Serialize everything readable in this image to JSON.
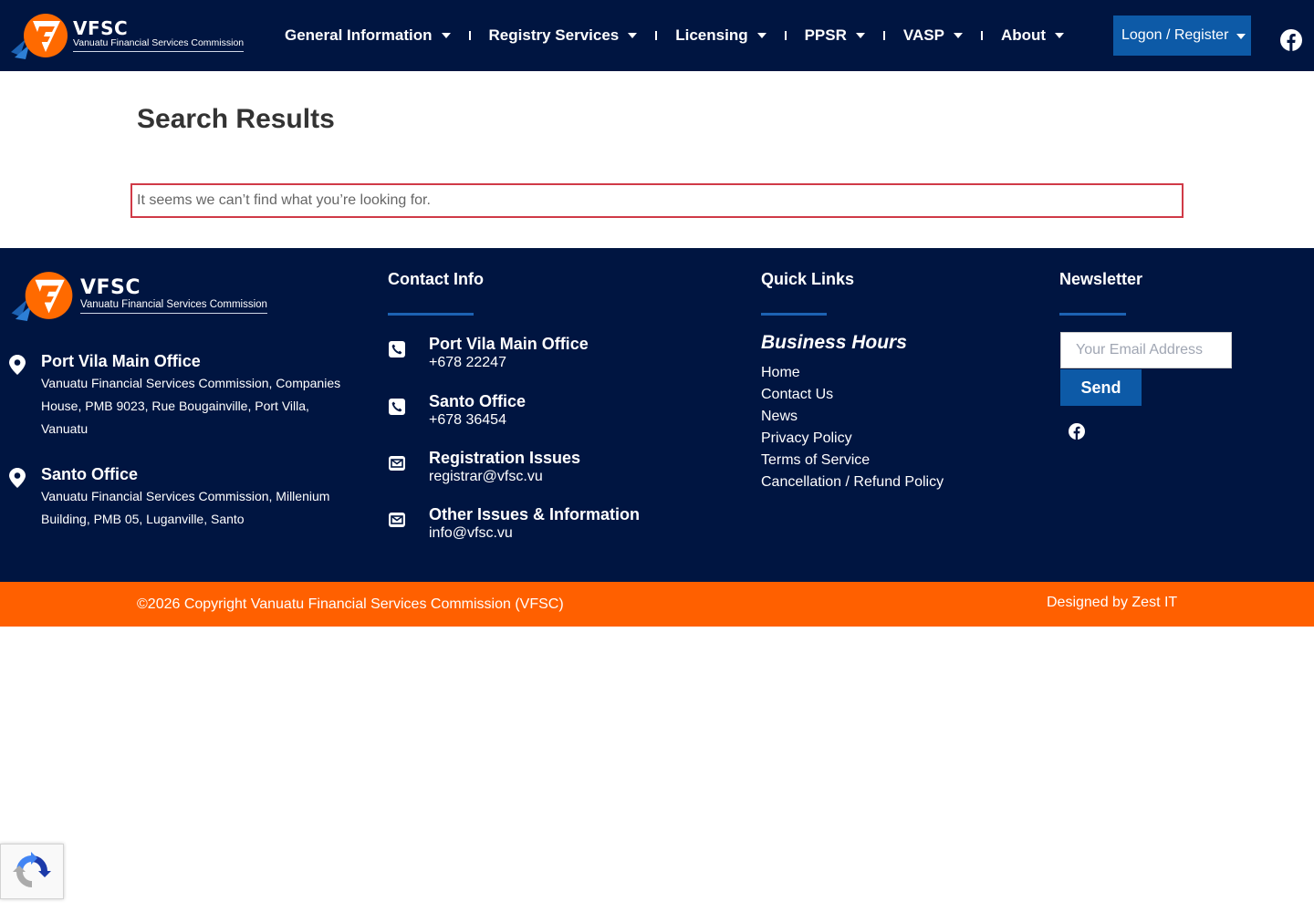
{
  "header": {
    "logo": {
      "brand": "VFSC",
      "subtitle": "Vanuatu Financial Services Commission"
    },
    "nav": [
      {
        "label": "General Information"
      },
      {
        "label": "Registry Services"
      },
      {
        "label": "Licensing"
      },
      {
        "label": "PPSR"
      },
      {
        "label": "VASP"
      },
      {
        "label": "About"
      }
    ],
    "logon_label": "Logon / Register",
    "social_icon": "facebook-icon"
  },
  "main": {
    "title": "Search Results",
    "notice": "It seems we can’t find what you’re looking for."
  },
  "footer": {
    "logo": {
      "brand": "VFSC",
      "subtitle": "Vanuatu Financial Services Commission"
    },
    "offices": [
      {
        "name": "Port Vila Main Office",
        "address": "Vanuatu Financial Services Commission, Companies House, PMB 9023, Rue Bougainville, Port Villa, Vanuatu"
      },
      {
        "name": "Santo Office",
        "address": "Vanuatu Financial Services Commission, Millenium Building, PMB 05, Luganville, Santo"
      }
    ],
    "contact_heading": "Contact Info",
    "contacts": [
      {
        "title": "Port Vila Main Office",
        "value": "+678 22247",
        "icon": "phone-icon"
      },
      {
        "title": "Santo Office",
        "value": "+678 36454",
        "icon": "phone-icon"
      },
      {
        "title": "Registration Issues",
        "value": "registrar@vfsc.vu",
        "icon": "envelope-icon"
      },
      {
        "title": "Other Issues & Information",
        "value": "info@vfsc.vu",
        "icon": "envelope-icon"
      }
    ],
    "quicklinks_heading": "Quick Links",
    "business_hours": "Business Hours",
    "quicklinks": [
      {
        "label": "Home"
      },
      {
        "label": "Contact Us"
      },
      {
        "label": "News"
      },
      {
        "label": "Privacy Policy"
      },
      {
        "label": "Terms of Service"
      },
      {
        "label": "Cancellation / Refund Policy"
      }
    ],
    "newsletter_heading": "Newsletter",
    "email_placeholder": "Your Email Address",
    "send_label": "Send",
    "copyright": "©2026 Copyright Vanuatu Financial Services Commission (VFSC)",
    "designed_by": "Designed by Zest IT"
  },
  "colors": {
    "navy": "#001541",
    "accent_blue": "#0d5aa7",
    "orange": "#ff6000",
    "alert_red": "#d03a47"
  }
}
